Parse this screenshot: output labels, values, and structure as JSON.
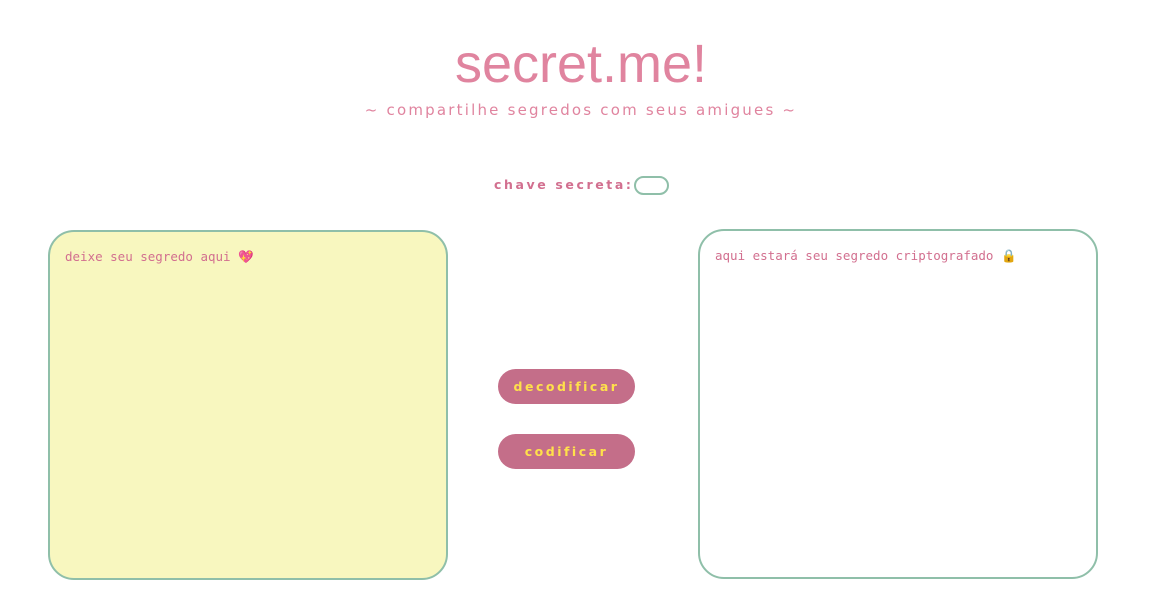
{
  "header": {
    "title": "secret.me!",
    "subtitle": "~ compartilhe segredos com seus amigues ~"
  },
  "key": {
    "label": "chave secreta:",
    "value": ""
  },
  "input_panel": {
    "placeholder": "deixe seu segredo aqui 💖",
    "value": "",
    "background": "#f8f7bf"
  },
  "output_panel": {
    "placeholder": "aqui estará seu segredo criptografado 🔒",
    "value": ""
  },
  "buttons": {
    "decode_label": "decodificar",
    "encode_label": "codificar"
  },
  "colors": {
    "accent_pink": "#e0849f",
    "button_bg": "#c46e89",
    "button_text": "#ffe14a",
    "border_green": "#8fbfa9"
  }
}
